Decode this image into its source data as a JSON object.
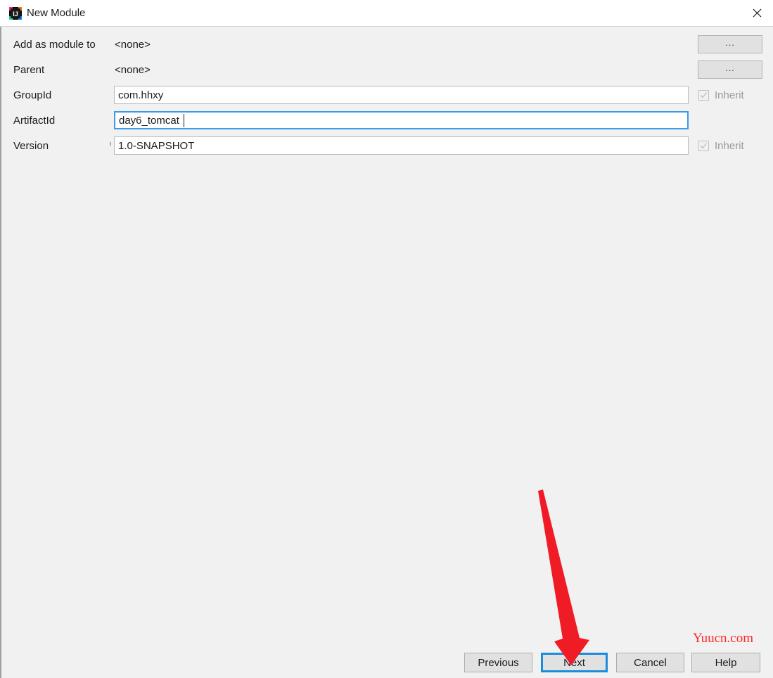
{
  "window": {
    "title": "New Module",
    "app_icon": "intellij-idea-icon",
    "close_icon": "close-icon"
  },
  "form": {
    "rows": [
      {
        "label": "Add as module to",
        "type": "static",
        "value": "<none>",
        "browse_label": "..."
      },
      {
        "label": "Parent",
        "type": "static",
        "value": "<none>",
        "browse_label": "..."
      },
      {
        "label": "GroupId",
        "type": "input",
        "value": "com.hhxy",
        "placeholder": "",
        "focused": false,
        "inherit_label": "Inherit",
        "inherit_checked": true
      },
      {
        "label": "ArtifactId",
        "type": "input",
        "value": "day6_tomcat",
        "placeholder": "",
        "focused": true,
        "inherit_label": "",
        "inherit_checked": false
      },
      {
        "label": "Version",
        "type": "input",
        "value": "1.0-SNAPSHOT",
        "placeholder": "",
        "focused": false,
        "inherit_label": "Inherit",
        "inherit_checked": true
      }
    ]
  },
  "footer": {
    "buttons": [
      {
        "label": "Previous",
        "default": false
      },
      {
        "label": "Next",
        "default": true
      },
      {
        "label": "Cancel",
        "default": false
      },
      {
        "label": "Help",
        "default": false
      }
    ]
  },
  "watermark": {
    "text": "Yuucn.com"
  },
  "annotation": {
    "arrow_color": "#ef1c25",
    "points_to": "Next"
  },
  "colors": {
    "dialog_background": "#f1f1f1",
    "titlebar_background": "#ffffff",
    "focus_blue": "#3d9ae8",
    "default_button_blue": "#1a8cdd",
    "watermark_red": "#ff2a2a",
    "annotation_red": "#ef1c25"
  }
}
